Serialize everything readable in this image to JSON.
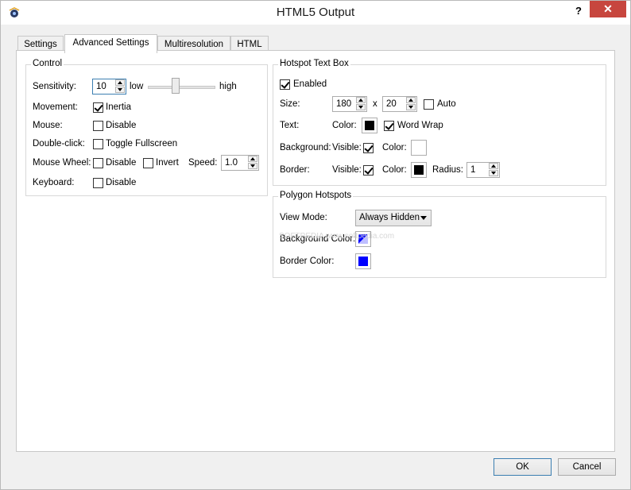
{
  "window": {
    "title": "HTML5 Output",
    "help_label": "?",
    "close_label": "✕",
    "app_icon": "panorama-app-icon"
  },
  "tabs": [
    {
      "label": "Settings",
      "active": false
    },
    {
      "label": "Advanced Settings",
      "active": true
    },
    {
      "label": "Multiresolution",
      "active": false
    },
    {
      "label": "HTML",
      "active": false
    }
  ],
  "control": {
    "title": "Control",
    "sensitivity": {
      "label": "Sensitivity:",
      "value": "10",
      "low_label": "low",
      "high_label": "high",
      "slider_level": 0.4
    },
    "movement": {
      "label": "Movement:",
      "inertia_label": "Inertia",
      "inertia_checked": true
    },
    "mouse": {
      "label": "Mouse:",
      "disable_label": "Disable",
      "disable_checked": false
    },
    "double_click": {
      "label": "Double-click:",
      "toggle_label": "Toggle Fullscreen",
      "toggle_checked": false
    },
    "mouse_wheel": {
      "label": "Mouse Wheel:",
      "disable_label": "Disable",
      "disable_checked": false,
      "invert_label": "Invert",
      "invert_checked": false,
      "speed_label": "Speed:",
      "speed_value": "1.0"
    },
    "keyboard": {
      "label": "Keyboard:",
      "disable_label": "Disable",
      "disable_checked": false
    }
  },
  "hotspot_text_box": {
    "title": "Hotspot Text Box",
    "enabled_label": "Enabled",
    "enabled_checked": true,
    "size": {
      "label": "Size:",
      "width": "180",
      "x_label": "x",
      "height": "20",
      "auto_label": "Auto",
      "auto_checked": false
    },
    "text": {
      "label": "Text:",
      "color_label": "Color:",
      "color": "#000000",
      "word_wrap_label": "Word Wrap",
      "word_wrap_checked": true
    },
    "background": {
      "label": "Background:",
      "visible_label": "Visible:",
      "visible_checked": true,
      "color_label": "Color:",
      "color": "#ffffff"
    },
    "border": {
      "label": "Border:",
      "visible_label": "Visible:",
      "visible_checked": true,
      "color_label": "Color:",
      "color": "#000000",
      "radius_label": "Radius:",
      "radius_value": "1"
    }
  },
  "polygon_hotspots": {
    "title": "Polygon Hotspots",
    "view_mode": {
      "label": "View Mode:",
      "value": "Always Hidden"
    },
    "background_color": {
      "label": "Background Color:",
      "color": "#0000ff",
      "semi_transparent": true
    },
    "border_color": {
      "label": "Border Color:",
      "color": "#0000ff"
    }
  },
  "watermark": "SOFTPEDIA www.softpedia.com",
  "buttons": {
    "ok": "OK",
    "cancel": "Cancel"
  }
}
